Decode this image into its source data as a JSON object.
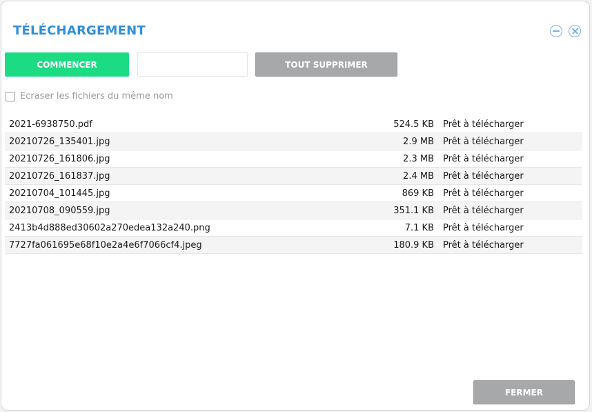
{
  "dialog": {
    "title": "TÉLÉCHARGEMENT",
    "minimize_icon": "minimize-circle-icon",
    "close_icon": "close-circle-icon"
  },
  "toolbar": {
    "start_label": "COMMENCER",
    "blank_label": "",
    "clear_all_label": "TOUT SUPPRIMER"
  },
  "options": {
    "overwrite_label": "Ecraser les fichiers du même nom",
    "overwrite_checked": false
  },
  "files": [
    {
      "name": "2021-6938750.pdf",
      "size": "524.5 KB",
      "status": "Prêt à télécharger"
    },
    {
      "name": "20210726_135401.jpg",
      "size": "2.9 MB",
      "status": "Prêt à télécharger"
    },
    {
      "name": "20210726_161806.jpg",
      "size": "2.3 MB",
      "status": "Prêt à télécharger"
    },
    {
      "name": "20210726_161837.jpg",
      "size": "2.4 MB",
      "status": "Prêt à télécharger"
    },
    {
      "name": "20210704_101445.jpg",
      "size": "869 KB",
      "status": "Prêt à télécharger"
    },
    {
      "name": "20210708_090559.jpg",
      "size": "351.1 KB",
      "status": "Prêt à télécharger"
    },
    {
      "name": "2413b4d888ed30602a270edea132a240.png",
      "size": "7.1 KB",
      "status": "Prêt à télécharger"
    },
    {
      "name": "7727fa061695e68f10e2a4e6f7066cf4.jpeg",
      "size": "180.9 KB",
      "status": "Prêt à télécharger"
    }
  ],
  "footer": {
    "close_label": "FERMER"
  },
  "colors": {
    "accent": "#2f8fd8",
    "start_button": "#1bdc83",
    "neutral_button": "#a7a8aa"
  }
}
